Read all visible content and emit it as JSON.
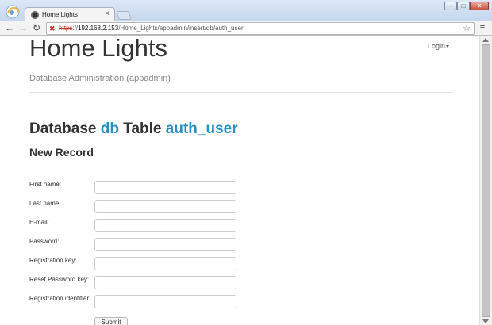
{
  "browser": {
    "tab_title": "Home Lights",
    "tab_close": "×",
    "url_scheme": "https",
    "url_sep": "://",
    "url_host": "192.168.2.153",
    "url_path": "/Home_Lights/appadmin/insert/db/auth_user"
  },
  "page": {
    "brand": "Home Lights",
    "login_label": "Login",
    "subtitle": "Database Administration (appadmin)",
    "heading_prefix": "Database",
    "heading_db": "db",
    "heading_mid": "Table",
    "heading_table": "auth_user",
    "section_title": "New Record",
    "fields": [
      {
        "label": "First name:",
        "value": ""
      },
      {
        "label": "Last name:",
        "value": ""
      },
      {
        "label": "E-mail:",
        "value": ""
      },
      {
        "label": "Password:",
        "value": ""
      },
      {
        "label": "Registration key:",
        "value": ""
      },
      {
        "label": "Reset Password key:",
        "value": ""
      },
      {
        "label": "Registration identifier:",
        "value": ""
      }
    ],
    "submit_label": "Submit"
  },
  "colors": {
    "accent": "#2a8fc1",
    "text": "#333333",
    "muted": "#888888"
  }
}
